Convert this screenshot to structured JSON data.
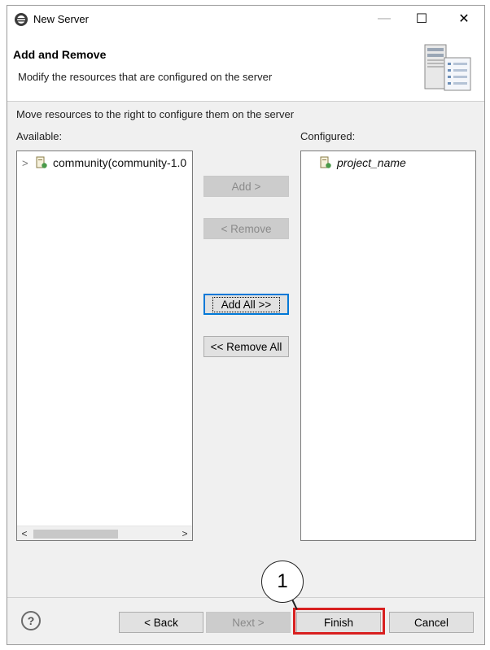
{
  "window": {
    "title": "New Server",
    "minimize_glyph": "—",
    "maximize_glyph": "☐",
    "close_glyph": "✕"
  },
  "header": {
    "title": "Add and Remove",
    "subtitle": "Modify the resources that are configured on the server",
    "icon": "server-config-icon"
  },
  "body": {
    "instruction": "Move resources to the right to configure them on the server",
    "available_label": "Available:",
    "configured_label": "Configured:",
    "available_items": [
      {
        "label": "community(community-1.0",
        "icon": "project-icon",
        "expandable": true
      }
    ],
    "configured_items": [
      {
        "label": "project_name",
        "icon": "project-icon"
      }
    ]
  },
  "buttons": {
    "add": "Add >",
    "remove": "< Remove",
    "add_all": "Add All >>",
    "remove_all": "<< Remove All",
    "back": "< Back",
    "next": "Next >",
    "finish": "Finish",
    "cancel": "Cancel"
  },
  "annotation": {
    "callout_number": "1",
    "highlight_color": "#d82020"
  }
}
